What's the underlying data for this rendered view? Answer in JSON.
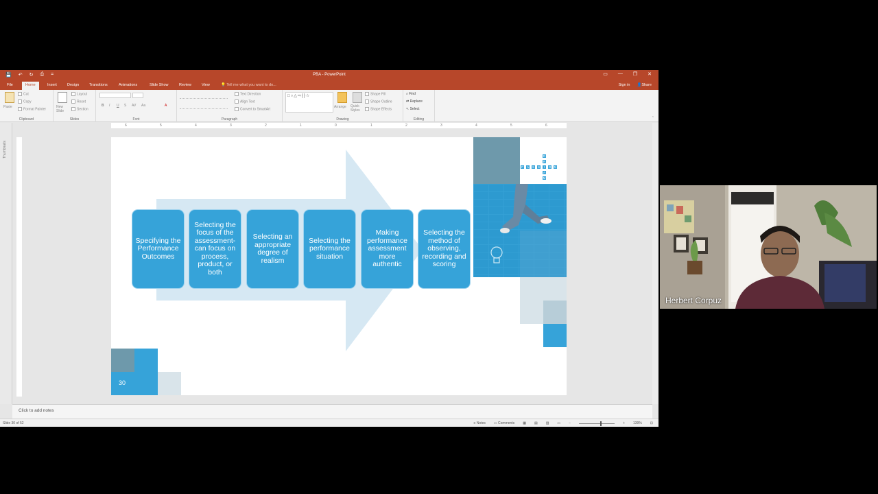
{
  "window": {
    "title": "PBA - PowerPoint"
  },
  "titlebar": {
    "qat": [
      "💾",
      "↶",
      "↻",
      "⎙",
      "="
    ],
    "controls": [
      "▭",
      "—",
      "❐",
      "✕"
    ]
  },
  "ribbon_tabs": [
    "File",
    "Home",
    "Insert",
    "Design",
    "Transitions",
    "Animations",
    "Slide Show",
    "Review",
    "View"
  ],
  "active_tab": "Home",
  "tell_me": "Tell me what you want to do...",
  "account": {
    "signin": "Sign in",
    "share": "Share"
  },
  "ribbon": {
    "clipboard": {
      "paste": "Paste",
      "cut": "Cut",
      "copy": "Copy",
      "format_painter": "Format Painter",
      "label": "Clipboard"
    },
    "slides": {
      "new_slide": "New Slide",
      "layout": "Layout",
      "reset": "Reset",
      "section": "Section",
      "label": "Slides"
    },
    "font": {
      "bold": "B",
      "italic": "I",
      "underline": "U",
      "strike": "S",
      "spacing": "AV",
      "case": "Aa",
      "color": "A",
      "label": "Font"
    },
    "paragraph": {
      "text_direction": "Text Direction",
      "align_text": "Align Text",
      "smartart": "Convert to SmartArt",
      "label": "Paragraph"
    },
    "drawing": {
      "shapes": "□○△⇨{}☆",
      "arrange": "Arrange",
      "quick_styles": "Quick Styles",
      "shape_fill": "Shape Fill",
      "shape_outline": "Shape Outline",
      "shape_effects": "Shape Effects",
      "label": "Drawing"
    },
    "editing": {
      "find": "Find",
      "replace": "Replace",
      "select": "Select",
      "label": "Editing"
    }
  },
  "ruler_ticks": [
    "6",
    "5",
    "4",
    "3",
    "2",
    "1",
    "0",
    "1",
    "2",
    "3",
    "4",
    "5",
    "6"
  ],
  "thumbnails_label": "Thumbnails",
  "slide": {
    "steps": [
      "Specifying the Performance Outcomes",
      "Selecting the focus of the assessment- can focus on process, product, or both",
      "Selecting an appropriate degree of realism",
      "Selecting the performance situation",
      "Making performance assessment more authentic",
      "Selecting the method of observing, recording and scoring"
    ],
    "number": "30",
    "tiles_word_across": "PASSION",
    "tiles_word_down": "DREAM"
  },
  "notes_placeholder": "Click to add notes",
  "status": {
    "slide_info": "Slide 30 of 52",
    "notes": "Notes",
    "comments": "Comments",
    "zoom": "139%"
  },
  "webcam": {
    "name": "Herbert Corpuz"
  },
  "colors": {
    "accent": "#b7472a",
    "step_blue": "#36a3d9",
    "arrow_light": "#d6e8f3",
    "slate": "#6e99ab"
  }
}
